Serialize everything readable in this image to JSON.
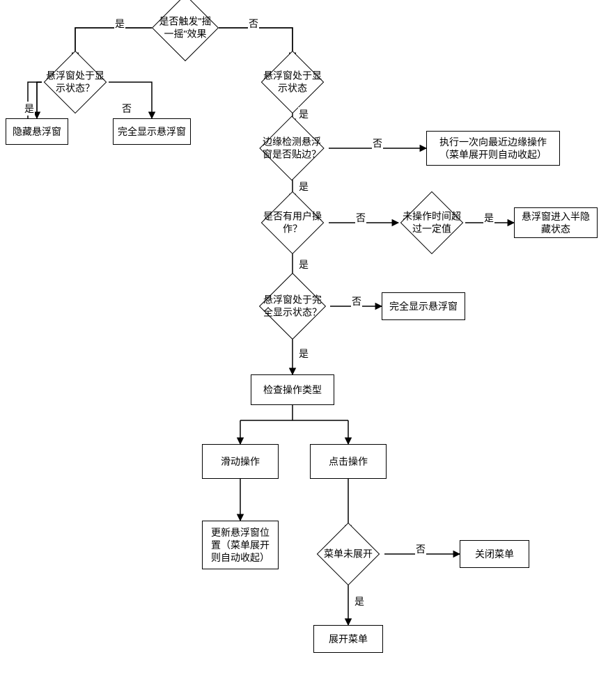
{
  "chart_data": {
    "type": "flowchart",
    "nodes": [
      {
        "id": "d1",
        "shape": "diamond",
        "text": "是否触发\"摇一摇\"效果"
      },
      {
        "id": "d2",
        "shape": "diamond",
        "text": "悬浮窗处于显示状态？"
      },
      {
        "id": "r1",
        "shape": "rect",
        "text": "隐藏悬浮窗"
      },
      {
        "id": "r2",
        "shape": "rect",
        "text": "完全显示悬浮窗"
      },
      {
        "id": "d3",
        "shape": "diamond",
        "text": "悬浮窗处于显示状态"
      },
      {
        "id": "d4",
        "shape": "diamond",
        "text": "边缘检测悬浮窗是否贴边？"
      },
      {
        "id": "r3",
        "shape": "rect",
        "text": "执行一次向最近边缘操作（菜单展开则自动收起）"
      },
      {
        "id": "d5",
        "shape": "diamond",
        "text": "是否有用户操作？"
      },
      {
        "id": "d6",
        "shape": "diamond",
        "text": "未操作时间超过一定值"
      },
      {
        "id": "r4",
        "shape": "rect",
        "text": "悬浮窗进入半隐藏状态"
      },
      {
        "id": "d7",
        "shape": "diamond",
        "text": "悬浮窗处于完全显示状态？"
      },
      {
        "id": "r5",
        "shape": "rect",
        "text": "完全显示悬浮窗"
      },
      {
        "id": "r6",
        "shape": "rect",
        "text": "检查操作类型"
      },
      {
        "id": "r7",
        "shape": "rect",
        "text": "滑动操作"
      },
      {
        "id": "r8",
        "shape": "rect",
        "text": "点击操作"
      },
      {
        "id": "r9",
        "shape": "rect",
        "text": "更新悬浮窗位置（菜单展开则自动收起）"
      },
      {
        "id": "d8",
        "shape": "diamond",
        "text": "菜单未展开"
      },
      {
        "id": "r10",
        "shape": "rect",
        "text": "关闭菜单"
      },
      {
        "id": "r11",
        "shape": "rect",
        "text": "展开菜单"
      }
    ],
    "edges": [
      {
        "from": "d1",
        "to": "d2",
        "label": "是"
      },
      {
        "from": "d1",
        "to": "d3",
        "label": "否"
      },
      {
        "from": "d2",
        "to": "r1",
        "label": "是"
      },
      {
        "from": "d2",
        "to": "r2",
        "label": "否"
      },
      {
        "from": "d3",
        "to": "d4",
        "label": "是"
      },
      {
        "from": "d4",
        "to": "r3",
        "label": "否"
      },
      {
        "from": "d4",
        "to": "d5",
        "label": "是"
      },
      {
        "from": "d5",
        "to": "d6",
        "label": "否"
      },
      {
        "from": "d6",
        "to": "r4",
        "label": "是"
      },
      {
        "from": "d5",
        "to": "d7",
        "label": "是"
      },
      {
        "from": "d7",
        "to": "r5",
        "label": "否"
      },
      {
        "from": "d7",
        "to": "r6",
        "label": "是"
      },
      {
        "from": "r6",
        "to": "r7"
      },
      {
        "from": "r6",
        "to": "r8"
      },
      {
        "from": "r7",
        "to": "r9"
      },
      {
        "from": "r8",
        "to": "d8"
      },
      {
        "from": "d8",
        "to": "r10",
        "label": "否"
      },
      {
        "from": "d8",
        "to": "r11",
        "label": "是"
      }
    ]
  },
  "labels": {
    "yes": "是",
    "no": "否"
  },
  "nodes": {
    "d1": "是否触发\"摇<br>一摇\"效果",
    "d2": "悬浮窗处于显<br>示状态？",
    "d3": "悬浮窗处于显<br>示状态",
    "d4": "边缘检测悬浮<br>窗是否贴边？",
    "d5": "是否有用户操<br>作？",
    "d6": "未操作时间超<br>过一定值",
    "d7": "悬浮窗处于完<br>全显示状态？",
    "d8": "菜单未展开",
    "r1": "隐藏悬浮窗",
    "r2": "完全显示悬浮窗",
    "r3": "执行一次向最近边缘操作<br>（菜单展开则自动收起）",
    "r4": "悬浮窗进入半隐<br>藏状态",
    "r5": "完全显示悬浮窗",
    "r6": "检查操作类型",
    "r7": "滑动操作",
    "r8": "点击操作",
    "r9": "更新悬浮窗位<br>置（菜单展开<br>则自动收起）",
    "r10": "关闭菜单",
    "r11": "展开菜单"
  }
}
